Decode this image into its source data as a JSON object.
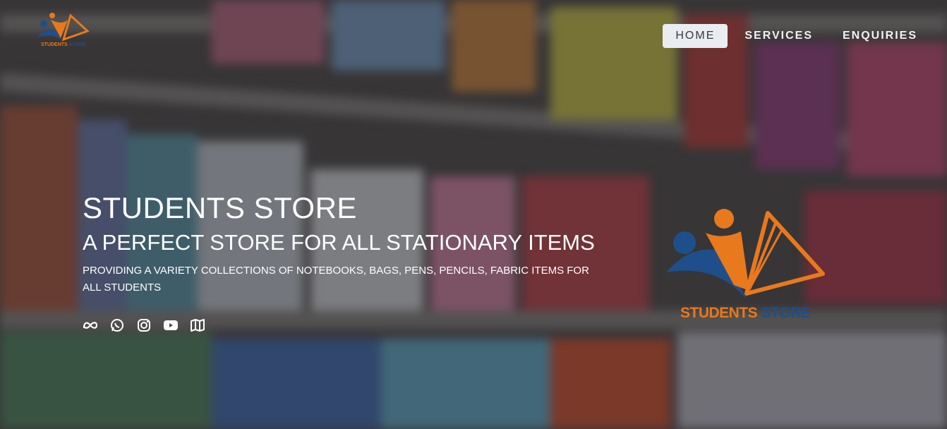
{
  "nav": {
    "items": [
      {
        "label": "HOME",
        "active": true
      },
      {
        "label": "SERVICES",
        "active": false
      },
      {
        "label": "ENQUIRIES",
        "active": false
      }
    ]
  },
  "brand": {
    "logo_text_part1": "STUDENTS",
    "logo_text_part2": "STORE",
    "orange": "#e8791d",
    "blue": "#1e4f8a"
  },
  "hero": {
    "title": "STUDENTS STORE",
    "subtitle": "A PERFECT STORE FOR ALL STATIONARY ITEMS",
    "description": "PROVIDING A VARIETY COLLECTIONS OF NOTEBOOKS, BAGS, PENS, PENCILS, FABRIC ITEMS FOR ALL STUDENTS"
  },
  "socials": [
    "meta-icon",
    "whatsapp-icon",
    "instagram-icon",
    "youtube-icon",
    "map-icon"
  ]
}
